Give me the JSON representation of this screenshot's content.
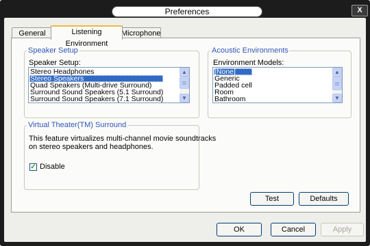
{
  "window": {
    "title": "Preferences",
    "close_label": "X"
  },
  "tabs": [
    {
      "label": "General",
      "active": false
    },
    {
      "label": "Listening Environment",
      "active": true
    },
    {
      "label": "Microphone",
      "active": false
    }
  ],
  "speaker_setup": {
    "legend": "Speaker Setup",
    "label": "Speaker Setup:",
    "options": [
      "Stereo Headphones",
      "Stereo Speakers",
      "Quad Speakers (Multi-drive Surround)",
      "Surround Sound Speakers (5.1 Surround)",
      "Surround Sound Speakers (7.1 Surround)"
    ],
    "selected": "Stereo Speakers"
  },
  "acoustic": {
    "legend": "Acoustic Environments",
    "label": "Environment Models:",
    "options": [
      "[None]",
      "Generic",
      "Padded cell",
      "Room",
      "Bathroom"
    ],
    "selected": "[None]"
  },
  "virtual_theater": {
    "legend": "Virtual Theater(TM) Surround",
    "description_line1": "This feature virtualizes multi-channel movie soundtracks",
    "description_line2": "on stereo speakers and headphones.",
    "disable_label": "Disable",
    "disable_checked": true
  },
  "buttons": {
    "test": "Test",
    "defaults": "Defaults",
    "ok": "OK",
    "cancel": "Cancel",
    "apply": "Apply"
  },
  "colors": {
    "legend_text": "#2e55b8",
    "selection": "#316ac5",
    "active_tab_accent": "#f0b640",
    "window_frame": "#1c1c1c"
  }
}
